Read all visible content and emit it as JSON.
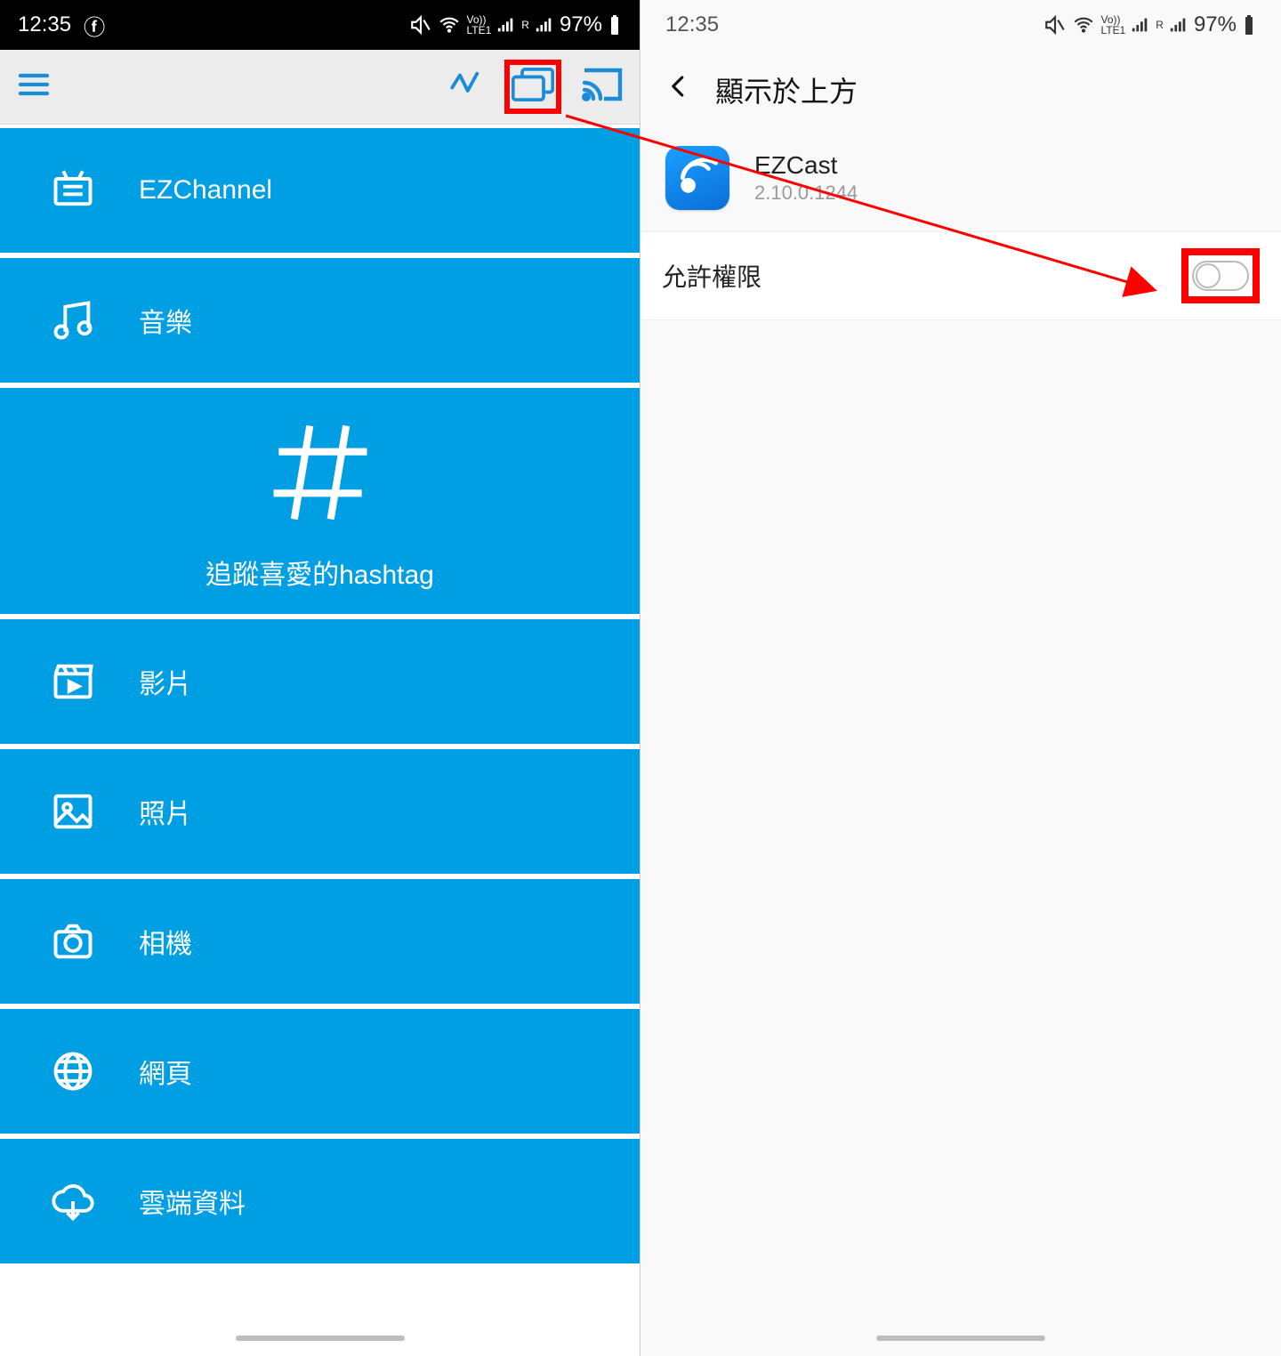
{
  "status_left": {
    "time": "12:35",
    "battery": "97%"
  },
  "status_right": {
    "time": "12:35",
    "battery": "97%"
  },
  "left_menu": {
    "items": [
      {
        "key": "ezchannel",
        "label": "EZChannel"
      },
      {
        "key": "music",
        "label": "音樂"
      },
      {
        "key": "hashtag",
        "label": "追蹤喜愛的hashtag"
      },
      {
        "key": "video",
        "label": "影片"
      },
      {
        "key": "photo",
        "label": "照片"
      },
      {
        "key": "camera",
        "label": "相機"
      },
      {
        "key": "web",
        "label": "網頁"
      },
      {
        "key": "cloud",
        "label": "雲端資料"
      }
    ]
  },
  "right_settings": {
    "header_title": "顯示於上方",
    "app_name": "EZCast",
    "app_version": "2.10.0.1244",
    "permission_label": "允許權限",
    "permission_on": false
  },
  "colors": {
    "accent": "#009fe3",
    "accent_toolbar": "#1a8cd8",
    "highlight": "#ff0000"
  }
}
